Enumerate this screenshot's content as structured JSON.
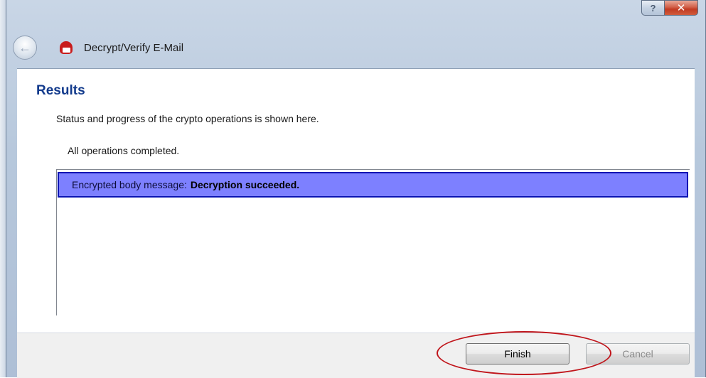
{
  "window": {
    "title": "Decrypt/Verify E-Mail",
    "help_label": "?",
    "close_label": "✕",
    "back_glyph": "←"
  },
  "page": {
    "heading": "Results",
    "subtitle": "Status and progress of the crypto operations is shown here.",
    "status": "All operations completed."
  },
  "results": [
    {
      "label": "Encrypted body message:",
      "value": "Decryption succeeded.",
      "selected": true
    }
  ],
  "buttons": {
    "finish": "Finish",
    "cancel": "Cancel"
  },
  "colors": {
    "heading": "#123a8c",
    "selection": "#7d80ff",
    "highlight": "#c0151b"
  }
}
